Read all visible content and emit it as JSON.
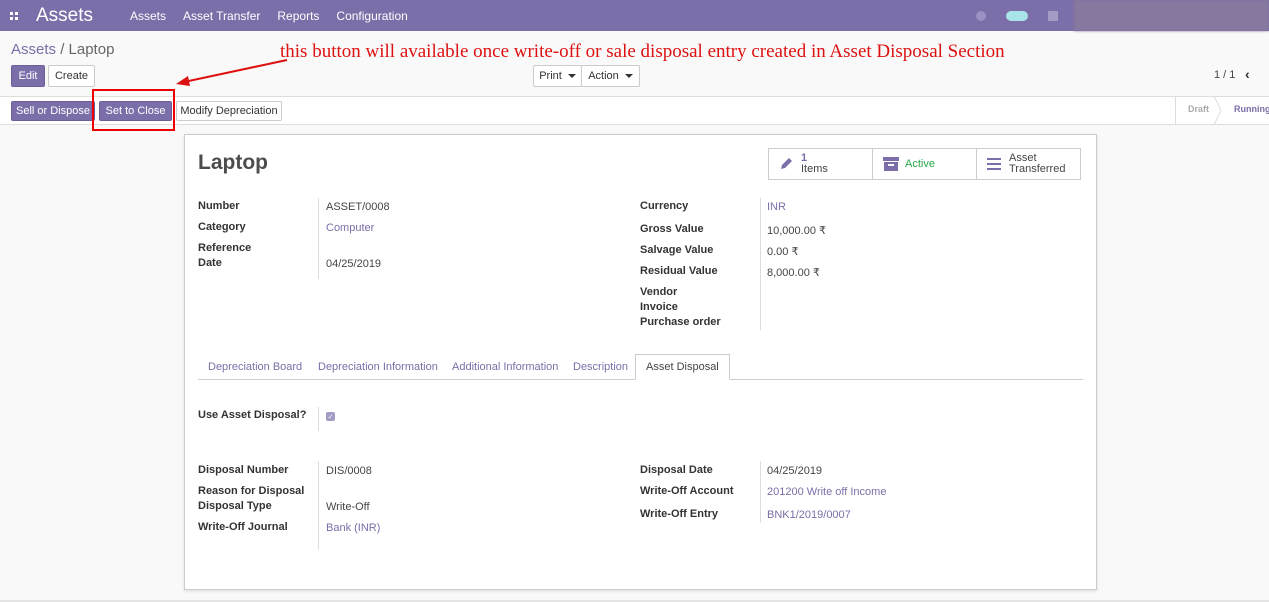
{
  "topbar": {
    "app_name": "Assets",
    "menu": [
      "Assets",
      "Asset Transfer",
      "Reports",
      "Configuration"
    ],
    "apps_icon": "apps-grid-icon"
  },
  "control_panel": {
    "breadcrumb_parent": "Assets",
    "breadcrumb_separator": "/",
    "breadcrumb_current": "Laptop",
    "edit_label": "Edit",
    "create_label": "Create",
    "print_label": "Print",
    "action_label": "Action",
    "pager": "1 / 1",
    "pager_prev": "‹"
  },
  "annotation": {
    "text": "this button will available once write-off or sale disposal entry created in Asset Disposal Section",
    "color": "#dd1111"
  },
  "statusbar": {
    "sell_dispose_label": "Sell or Dispose",
    "set_to_close_label": "Set to Close",
    "modify_depreciation_label": "Modify Depreciation",
    "stages": [
      "Draft",
      "Running"
    ],
    "current_stage": "Running"
  },
  "record": {
    "title": "Laptop",
    "smart_buttons": {
      "items_count": "1",
      "items_label": "Items",
      "active_label": "Active",
      "transfer_label_1": "Asset",
      "transfer_label_2": "Transferred"
    },
    "left_fields": {
      "number_label": "Number",
      "number_value": "ASSET/0008",
      "category_label": "Category",
      "category_value": "Computer",
      "reference_label": "Reference",
      "date_label": "Date",
      "date_value": "04/25/2019"
    },
    "right_fields": {
      "currency_label": "Currency",
      "currency_value": "INR",
      "gross_label": "Gross Value",
      "gross_value": "10,000.00 ₹",
      "salvage_label": "Salvage Value",
      "salvage_value": "0.00 ₹",
      "residual_label": "Residual Value",
      "residual_value": "8,000.00 ₹",
      "vendor_label": "Vendor",
      "invoice_label": "Invoice",
      "po_label": "Purchase order"
    },
    "tabs": [
      "Depreciation Board",
      "Depreciation Information",
      "Additional Information",
      "Description",
      "Asset Disposal"
    ],
    "active_tab": "Asset Disposal",
    "disposal": {
      "use_label": "Use Asset Disposal?",
      "use_checked": true,
      "number_label": "Disposal Number",
      "number_value": "DIS/0008",
      "reason_label": "Reason for Disposal",
      "type_label": "Disposal Type",
      "type_value": "Write-Off",
      "journal_label": "Write-Off Journal",
      "journal_value": "Bank (INR)",
      "date_label": "Disposal Date",
      "date_value": "04/25/2019",
      "account_label": "Write-Off Account",
      "account_value": "201200 Write off Income",
      "entry_label": "Write-Off Entry",
      "entry_value": "BNK1/2019/0007"
    }
  },
  "colors": {
    "brand": "#7c6ea8",
    "active_green": "#28a745",
    "annotation_red": "#dd1111"
  }
}
